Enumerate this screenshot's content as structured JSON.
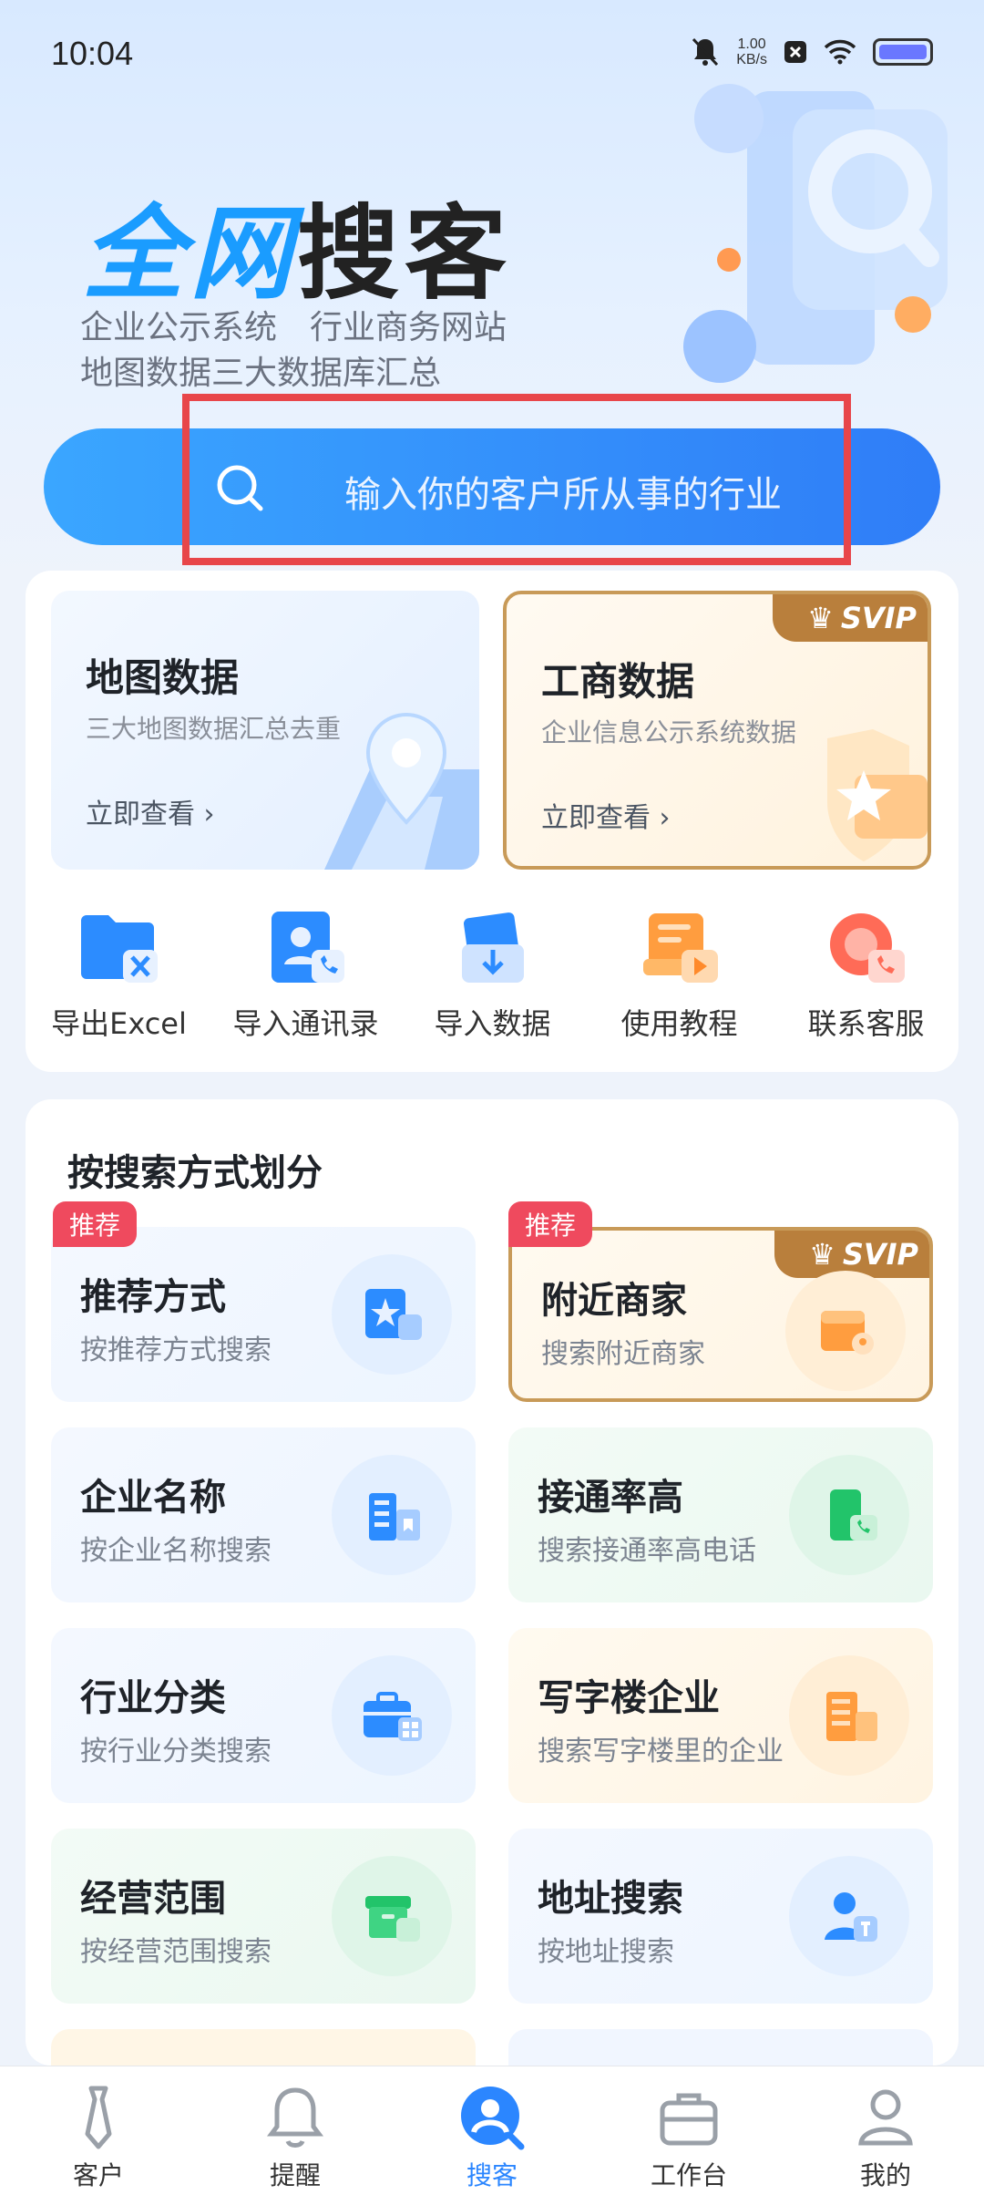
{
  "status_bar": {
    "time": "10:04",
    "speed_value": "1.00",
    "speed_unit": "KB/s"
  },
  "hero": {
    "title_part1": "全网",
    "title_part2": "搜客",
    "subtitle_line1": "企业公示系统　行业商务网站",
    "subtitle_line2": "地图数据三大数据库汇总"
  },
  "search": {
    "placeholder": "输入你的客户所从事的行业"
  },
  "data_tiles": [
    {
      "title": "地图数据",
      "desc": "三大地图数据汇总去重",
      "link": "立即查看 ›"
    },
    {
      "title": "工商数据",
      "desc": "企业信息公示系统数据",
      "link": "立即查看 ›",
      "badge": "SVIP"
    }
  ],
  "tools": [
    {
      "label": "导出Excel",
      "icon": "export-excel-icon"
    },
    {
      "label": "导入通讯录",
      "icon": "import-contacts-icon"
    },
    {
      "label": "导入数据",
      "icon": "import-data-icon"
    },
    {
      "label": "使用教程",
      "icon": "tutorial-icon"
    },
    {
      "label": "联系客服",
      "icon": "customer-service-icon"
    }
  ],
  "search_methods": {
    "title": "按搜索方式划分",
    "tag_label": "推荐",
    "svip_label": "SVIP",
    "items": [
      {
        "title": "推荐方式",
        "desc": "按推荐方式搜索"
      },
      {
        "title": "附近商家",
        "desc": "搜索附近商家"
      },
      {
        "title": "企业名称",
        "desc": "按企业名称搜索"
      },
      {
        "title": "接通率高",
        "desc": "搜索接通率高电话"
      },
      {
        "title": "行业分类",
        "desc": "按行业分类搜索"
      },
      {
        "title": "写字楼企业",
        "desc": "搜索写字楼里的企业"
      },
      {
        "title": "经营范围",
        "desc": "按经营范围搜索"
      },
      {
        "title": "地址搜索",
        "desc": "按地址搜索"
      }
    ]
  },
  "tabbar": [
    {
      "label": "客户"
    },
    {
      "label": "提醒"
    },
    {
      "label": "搜客",
      "active": true
    },
    {
      "label": "工作台"
    },
    {
      "label": "我的"
    }
  ],
  "colors": {
    "accent": "#2b86ff",
    "highlight_box": "#e8464a",
    "svip_gold": "#b97f3c",
    "tag_red": "#ef4a5e"
  }
}
